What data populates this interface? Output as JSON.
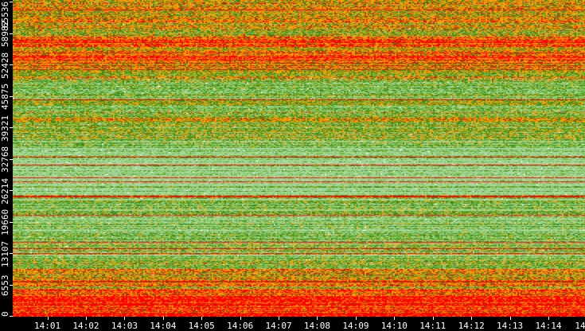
{
  "chart_data": {
    "type": "heatmap",
    "title": "",
    "xlabel": "",
    "ylabel": "",
    "y_ticks": [
      "0",
      "6553",
      "13107",
      "19660",
      "26214",
      "32768",
      "39321",
      "45875",
      "52428",
      "58982",
      "65536"
    ],
    "y_range": [
      0,
      65536
    ],
    "x_ticks": [
      "14:01",
      "14:02",
      "14:03",
      "14:04",
      "14:05",
      "14:06",
      "14:07",
      "14:08",
      "14:09",
      "14:10",
      "14:11",
      "14:12",
      "14:13",
      "14:14",
      "14"
    ],
    "x_range_minutes": [
      0.1,
      14.95
    ],
    "colorscale": [
      "#a8d8a0",
      "#8cc870",
      "#6ab030",
      "#3f8a1a",
      "#ffa500",
      "#ff7000",
      "#ff0000"
    ],
    "band_intensity_bottom_to_top": [
      0.92,
      0.85,
      0.6,
      0.55,
      0.35,
      0.3,
      0.25,
      0.25,
      0.2,
      0.15,
      0.1,
      0.12,
      0.45,
      0.5,
      0.4,
      0.35,
      0.5,
      0.8,
      0.75,
      0.55,
      0.6,
      0.55
    ],
    "grid": false,
    "legend": "none"
  }
}
